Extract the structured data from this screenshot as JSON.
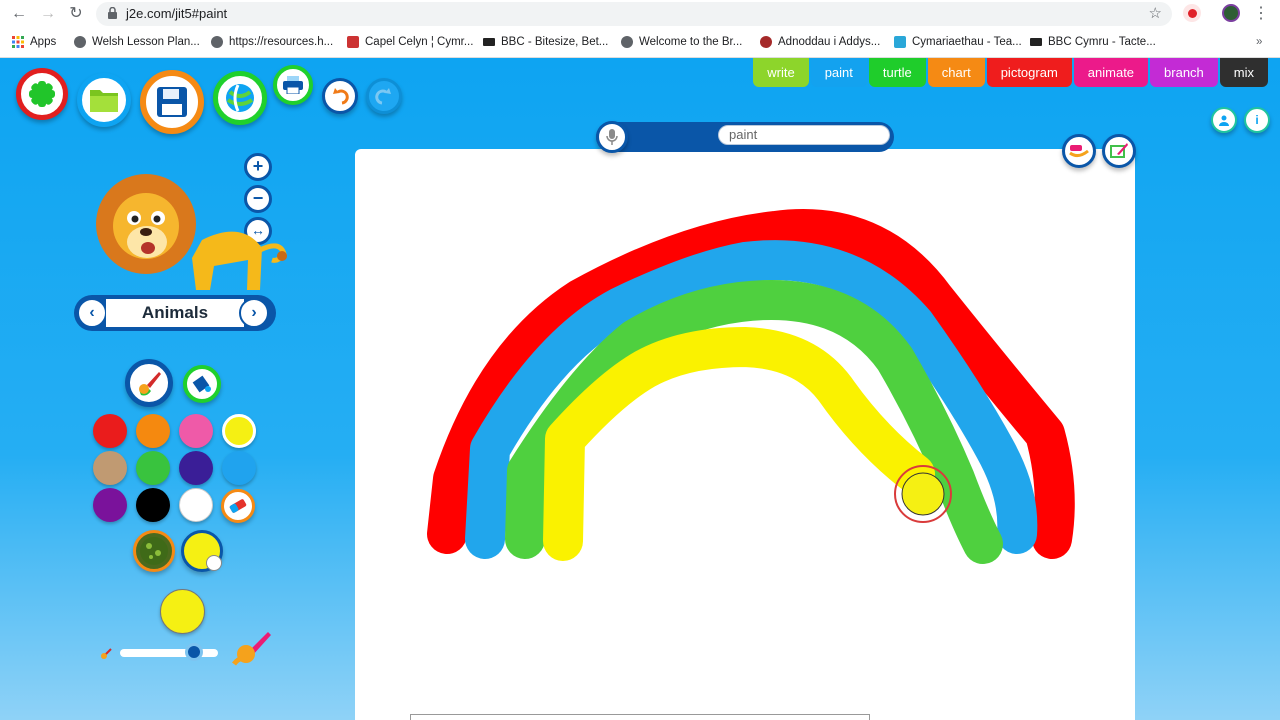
{
  "browser": {
    "url": "j2e.com/jit5#paint",
    "bookmarks": [
      "Apps",
      "Welsh Lesson Plan...",
      "https://resources.h...",
      "Capel Celyn ¦ Cymr...",
      "BBC - Bitesize, Bet...",
      "Welcome to the Br...",
      "Adnoddau i Addys...",
      "Cymariaethau - Tea...",
      "BBC Cymru - Tacte..."
    ],
    "overflow": "»"
  },
  "tabs": [
    {
      "label": "write",
      "color": "#8dd52b"
    },
    {
      "label": "paint",
      "color": "#13a2ef"
    },
    {
      "label": "turtle",
      "color": "#1fcd2b"
    },
    {
      "label": "chart",
      "color": "#f58a14"
    },
    {
      "label": "pictogram",
      "color": "#ef1d1d"
    },
    {
      "label": "animate",
      "color": "#ec1a8a"
    },
    {
      "label": "branch",
      "color": "#c32bd5"
    },
    {
      "label": "mix",
      "color": "#2f2f2f"
    }
  ],
  "toolbar": {
    "zoom_in": "+",
    "zoom_out": "−",
    "fit": "↔"
  },
  "document": {
    "title": "paint"
  },
  "stamps": {
    "category": "Animals",
    "prev": "‹",
    "next": "›"
  },
  "palette": {
    "colors": [
      "#ea1c1c",
      "#f5890f",
      "#ef5aa8",
      "#f5f013",
      "#c09a72",
      "#39c33e",
      "#3a1e97",
      "#20a3ee",
      "#7a129b",
      "#000000",
      "#ffffff"
    ],
    "selected_color": "#f5f013",
    "brush_size": 0.75
  },
  "drawing": {
    "arcs": [
      {
        "color": "#ff0000"
      },
      {
        "color": "#21a6ec"
      },
      {
        "color": "#4fd03f"
      },
      {
        "color": "#faf200"
      }
    ]
  },
  "icons": {
    "new": "new-icon",
    "open": "open-folder-icon",
    "save": "save-icon",
    "share": "share-icon",
    "print": "print-icon",
    "undo": "undo-icon",
    "redo": "redo-icon",
    "mic": "microphone-icon",
    "eraser": "eraser-icon"
  }
}
